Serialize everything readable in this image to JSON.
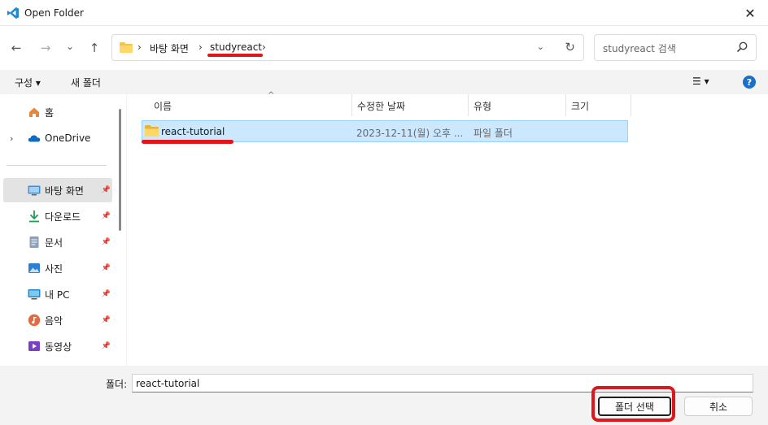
{
  "window": {
    "title": "Open Folder",
    "close_glyph": "✕"
  },
  "nav": {
    "back": "←",
    "forward": "→",
    "recent": "⌄",
    "up": "↑"
  },
  "address": {
    "crumbs": [
      "바탕 화면",
      "studyreact"
    ],
    "separator": "›",
    "dropdown": "⌄",
    "refresh": "↻"
  },
  "search": {
    "placeholder": "studyreact 검색"
  },
  "toolbar": {
    "organize": "구성 ▾",
    "new_folder": "새 폴더",
    "view": "☰ ▾",
    "help": "?"
  },
  "sidebar": {
    "items": [
      {
        "label": "홈",
        "icon": "home-icon",
        "pinned": false
      },
      {
        "label": "OneDrive",
        "icon": "cloud-icon",
        "pinned": false,
        "expander": "›"
      },
      {
        "label": "바탕 화면",
        "icon": "desktop-icon",
        "pinned": true,
        "selected": true
      },
      {
        "label": "다운로드",
        "icon": "download-icon",
        "pinned": true
      },
      {
        "label": "문서",
        "icon": "document-icon",
        "pinned": true
      },
      {
        "label": "사진",
        "icon": "pictures-icon",
        "pinned": true
      },
      {
        "label": "내 PC",
        "icon": "pc-icon",
        "pinned": true
      },
      {
        "label": "음악",
        "icon": "music-icon",
        "pinned": true
      },
      {
        "label": "동영상",
        "icon": "video-icon",
        "pinned": true
      }
    ],
    "pin_glyph": "📌"
  },
  "columns": [
    "이름",
    "수정한 날짜",
    "유형",
    "크기"
  ],
  "files": [
    {
      "name": "react-tutorial",
      "modified": "2023-12-11(월) 오후 ...",
      "type": "파일 폴더",
      "size": ""
    }
  ],
  "footer": {
    "folder_label": "폴더:",
    "folder_value": "react-tutorial",
    "select_button": "폴더 선택",
    "cancel_button": "취소"
  },
  "colors": {
    "accent": "#1a6fc9",
    "selection": "#cce8ff",
    "annotation": "#e0161b"
  }
}
